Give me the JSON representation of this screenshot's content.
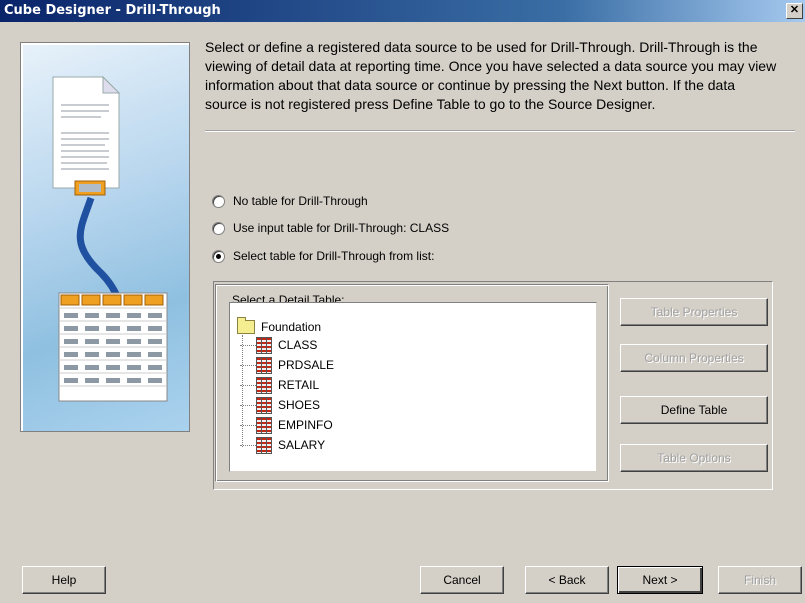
{
  "window": {
    "title": "Cube Designer - Drill-Through",
    "close_glyph": "✕"
  },
  "description": "Select or define a registered data source to be used for Drill-Through. Drill-Through is the viewing of detail data at reporting time. Once you have selected a data source you may view information about that data source or continue by pressing the Next button. If the data source is not registered press Define Table to go to the Source Designer.",
  "options": [
    {
      "label": "No table for Drill-Through",
      "checked": false
    },
    {
      "label": "Use input table for Drill-Through: CLASS",
      "checked": false
    },
    {
      "label": "Select table for Drill-Through from list:",
      "checked": true
    }
  ],
  "detail_group": {
    "label": "Select a Detail Table:",
    "root": "Foundation",
    "tables": [
      "CLASS",
      "PRDSALE",
      "RETAIL",
      "SHOES",
      "EMPINFO",
      "SALARY"
    ]
  },
  "side_buttons": {
    "table_properties": "Table Properties",
    "column_properties": "Column Properties",
    "define_table": "Define Table",
    "table_options": "Table Options"
  },
  "footer": {
    "help": "Help",
    "cancel": "Cancel",
    "back": "< Back",
    "next": "Next >",
    "finish": "Finish"
  },
  "icons": {
    "folder": "folder-icon",
    "table": "table-icon",
    "illustration": "wizard-illustration"
  }
}
